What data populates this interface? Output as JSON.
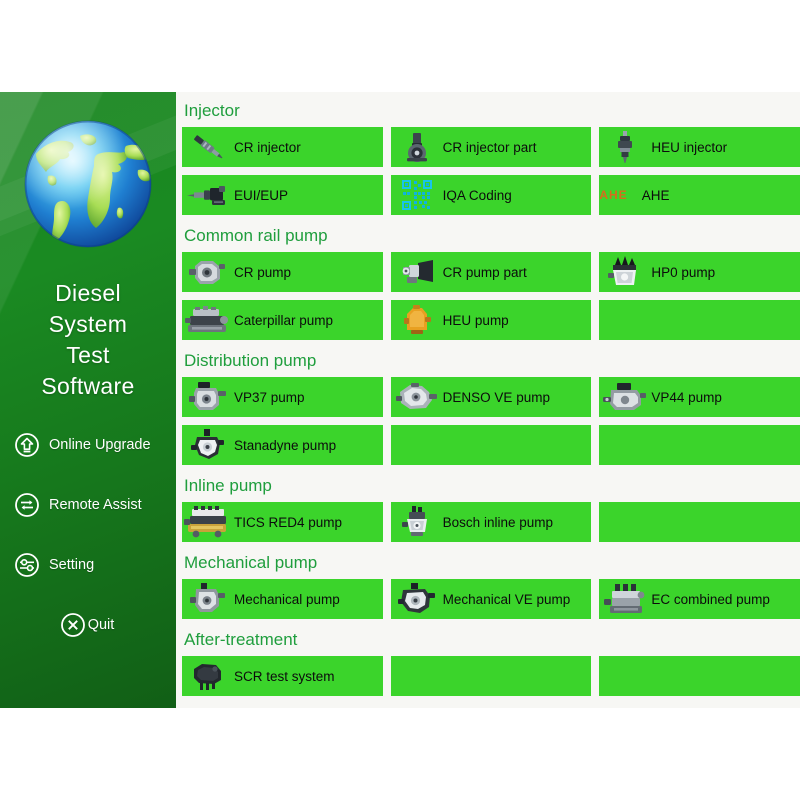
{
  "app": {
    "title_lines": [
      "Diesel",
      "System",
      "Test",
      "Software"
    ],
    "colors": {
      "sidebar_green_dark": "#115f16",
      "sidebar_green": "#1a8a22",
      "tile_green": "#3bd42b",
      "section_title_green": "#1f9e3d",
      "content_bg": "#f7f7f4",
      "label_black": "#0c0c0c",
      "ahe_orange": "#e8601c",
      "qr_cyan": "#18c4ea"
    }
  },
  "sidebar": {
    "logo_icon": "globe-icon",
    "items": [
      {
        "label": "Online Upgrade",
        "icon": "upload-circle-icon"
      },
      {
        "label": "Remote Assist",
        "icon": "exchange-circle-icon"
      },
      {
        "label": "Setting",
        "icon": "slider-circle-icon"
      },
      {
        "label": "Quit",
        "icon": "close-circle-icon"
      }
    ]
  },
  "content": {
    "sections": [
      {
        "title": "Injector",
        "tiles": [
          {
            "label": "CR injector",
            "icon": "injector-icon"
          },
          {
            "label": "CR injector part",
            "icon": "injector-part-icon"
          },
          {
            "label": "HEU injector",
            "icon": "heu-injector-icon"
          },
          {
            "label": "EUI/EUP",
            "icon": "eui-eup-icon"
          },
          {
            "label": "IQA Coding",
            "icon": "qr-code-icon"
          },
          {
            "label": "AHE",
            "icon": "ahe-text-icon"
          }
        ]
      },
      {
        "title": "Common rail pump",
        "tiles": [
          {
            "label": "CR pump",
            "icon": "cr-pump-icon"
          },
          {
            "label": "CR pump part",
            "icon": "cr-pump-part-icon"
          },
          {
            "label": "HP0 pump",
            "icon": "hp0-pump-icon"
          },
          {
            "label": "Caterpillar pump",
            "icon": "caterpillar-pump-icon"
          },
          {
            "label": "HEU pump",
            "icon": "heu-pump-icon"
          },
          {
            "label": "",
            "icon": ""
          }
        ]
      },
      {
        "title": "Distribution pump",
        "tiles": [
          {
            "label": "VP37 pump",
            "icon": "vp37-pump-icon"
          },
          {
            "label": "DENSO VE pump",
            "icon": "denso-ve-pump-icon"
          },
          {
            "label": "VP44 pump",
            "icon": "vp44-pump-icon"
          },
          {
            "label": "Stanadyne pump",
            "icon": "stanadyne-pump-icon"
          },
          {
            "label": "",
            "icon": ""
          },
          {
            "label": "",
            "icon": ""
          }
        ]
      },
      {
        "title": "Inline pump",
        "tiles": [
          {
            "label": "TICS RED4 pump",
            "icon": "tics-red4-pump-icon"
          },
          {
            "label": "Bosch inline pump",
            "icon": "bosch-inline-pump-icon"
          },
          {
            "label": "",
            "icon": ""
          }
        ]
      },
      {
        "title": "Mechanical pump",
        "tiles": [
          {
            "label": "Mechanical pump",
            "icon": "mechanical-pump-icon"
          },
          {
            "label": "Mechanical VE pump",
            "icon": "mechanical-ve-pump-icon"
          },
          {
            "label": "EC combined pump",
            "icon": "ec-combined-pump-icon"
          }
        ]
      },
      {
        "title": "After-treatment",
        "tiles": [
          {
            "label": "SCR test system",
            "icon": "scr-test-system-icon"
          },
          {
            "label": "",
            "icon": ""
          },
          {
            "label": "",
            "icon": ""
          }
        ]
      }
    ]
  }
}
